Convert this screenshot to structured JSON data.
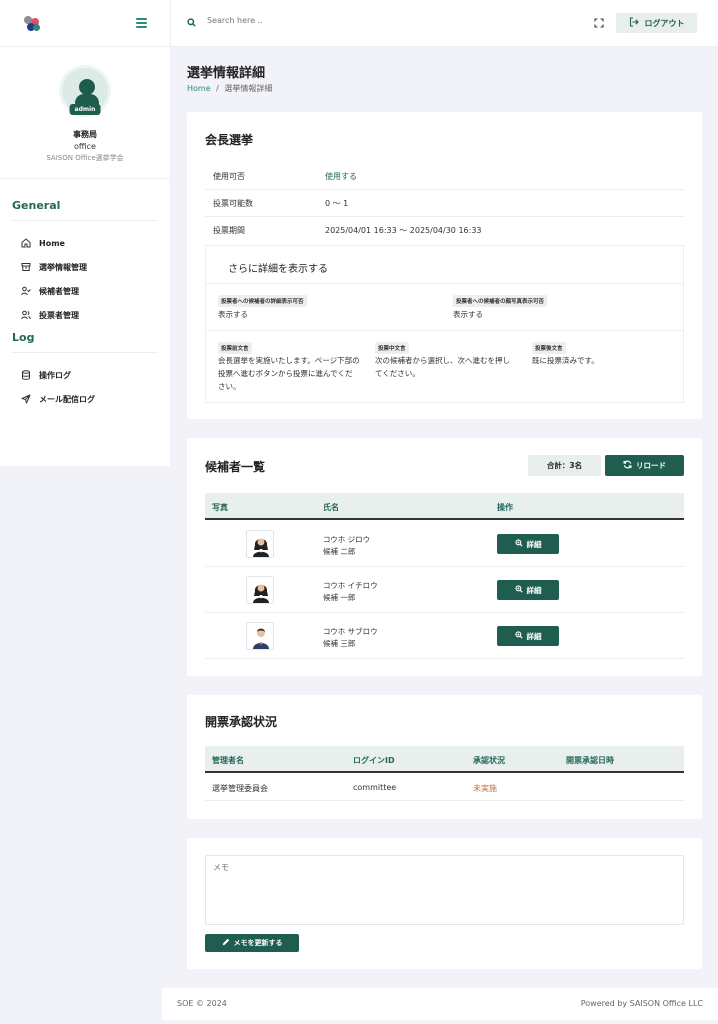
{
  "topbar": {
    "search_placeholder": "Search here ..",
    "logout_label": "ログアウト"
  },
  "sidebar": {
    "profile": {
      "badge": "admin",
      "name": "事務局",
      "role": "office",
      "org": "SAISON Office選挙学会"
    },
    "sections": [
      {
        "title": "General",
        "items": [
          {
            "label": "Home",
            "icon": "home-icon"
          },
          {
            "label": "選挙情報管理",
            "icon": "archive-icon"
          },
          {
            "label": "候補者管理",
            "icon": "user-check-icon"
          },
          {
            "label": "投票者管理",
            "icon": "users-icon"
          }
        ]
      },
      {
        "title": "Log",
        "items": [
          {
            "label": "操作ログ",
            "icon": "database-icon"
          },
          {
            "label": "メール配信ログ",
            "icon": "send-icon"
          }
        ]
      }
    ]
  },
  "header": {
    "title": "選挙情報詳細",
    "breadcrumb_home": "Home",
    "breadcrumb_sep": "/",
    "breadcrumb_current": "選挙情報詳細"
  },
  "election": {
    "title": "会長選挙",
    "rows": [
      {
        "label": "使用可否",
        "value": "使用する"
      },
      {
        "label": "投票可能数",
        "value": "0 〜 1"
      },
      {
        "label": "投票期間",
        "value": "2025/04/01 16:33 〜 2025/04/30 16:33"
      }
    ],
    "details": {
      "heading": "さらに詳細を表示する",
      "items": [
        {
          "tag": "投票者への候補者の詳細表示可否",
          "value": "表示する"
        },
        {
          "tag": "投票者への候補者の顔写真表示可否",
          "value": "表示する"
        },
        {
          "tag": "投票前文言",
          "value": "会長選挙を実施いたします。ページ下部の投票へ進むボタンから投票に進んでください。"
        },
        {
          "tag": "投票中文言",
          "value": "次の候補者から選択し、次へ進むを押してください。"
        },
        {
          "tag": "投票後文言",
          "value": "既に投票済みです。"
        }
      ]
    }
  },
  "candidates": {
    "title": "候補者一覧",
    "total": "合計：3名",
    "reload_label": "リロード",
    "columns": [
      "写真",
      "氏名",
      "操作"
    ],
    "rows": [
      {
        "kana": "コウホ ジロウ",
        "name": "候補 二郎",
        "gender": "female"
      },
      {
        "kana": "コウホ イチロウ",
        "name": "候補 一郎",
        "gender": "female"
      },
      {
        "kana": "コウホ サブロウ",
        "name": "候補 三郎",
        "gender": "male"
      }
    ],
    "detail_label": "詳細"
  },
  "approval": {
    "title": "開票承認状況",
    "columns": [
      "管理者名",
      "ログインID",
      "承認状況",
      "開票承認日時"
    ],
    "rows": [
      {
        "name": "選挙管理委員会",
        "login_id": "committee",
        "status": "未実施",
        "date": ""
      }
    ],
    "status_color": "#c0703a"
  },
  "memo": {
    "placeholder": "メモ",
    "button_label": "メモを更新する"
  },
  "footer": {
    "left": "SOE © 2024",
    "right": "Powered by SAISON Office LLC"
  },
  "colors": {
    "accent": "#1f5e4f",
    "accent_light": "#2b8a78"
  }
}
